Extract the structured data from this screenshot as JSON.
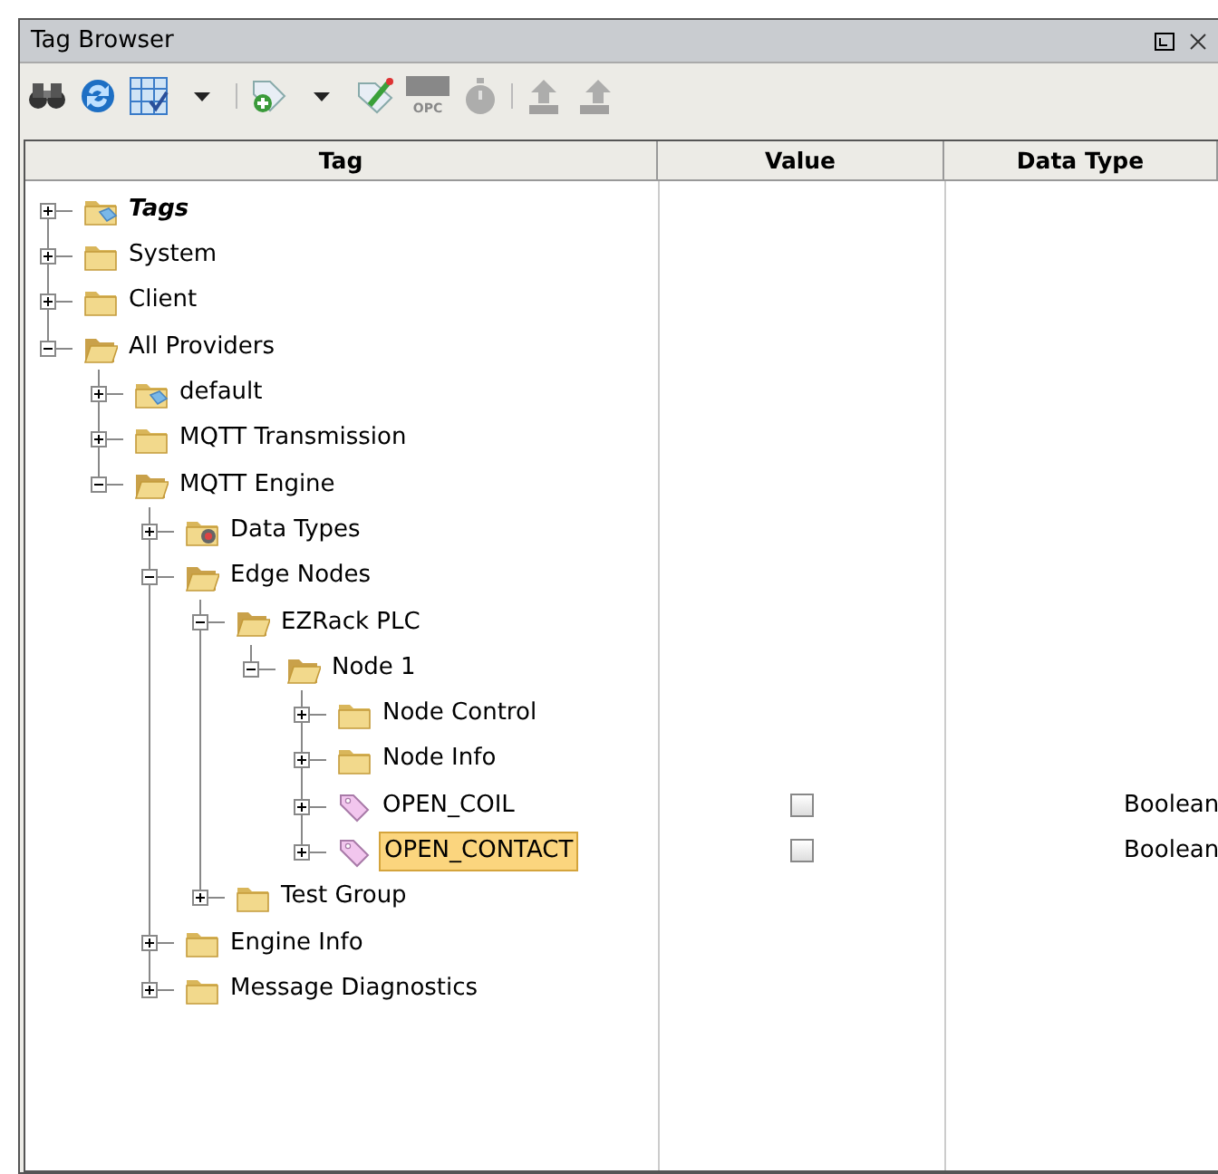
{
  "window": {
    "title": "Tag Browser"
  },
  "toolbar": [
    {
      "kind": "binoculars",
      "disabled": false
    },
    {
      "kind": "refresh",
      "disabled": false
    },
    {
      "kind": "grid",
      "disabled": false
    },
    {
      "kind": "caret",
      "disabled": false
    },
    {
      "kind": "separator"
    },
    {
      "kind": "tag-add",
      "disabled": false
    },
    {
      "kind": "caret",
      "disabled": false
    },
    {
      "kind": "tag-edit",
      "disabled": false
    },
    {
      "kind": "opc",
      "label": "OPC",
      "disabled": true
    },
    {
      "kind": "timer",
      "disabled": true
    },
    {
      "kind": "separator"
    },
    {
      "kind": "export",
      "disabled": true
    },
    {
      "kind": "import",
      "disabled": true
    }
  ],
  "columns": [
    "Tag",
    "Value",
    "Data Type"
  ],
  "tree": [
    {
      "label": "Tags",
      "kind": "root",
      "expanded": false,
      "selected": false
    },
    {
      "label": "System",
      "kind": "folder",
      "expanded": false,
      "selected": false
    },
    {
      "label": "Client",
      "kind": "folder",
      "expanded": false,
      "selected": false
    },
    {
      "label": "All Providers",
      "kind": "folder",
      "expanded": true,
      "selected": false,
      "children": [
        {
          "label": "default",
          "kind": "provider",
          "expanded": false,
          "selected": false
        },
        {
          "label": "MQTT Transmission",
          "kind": "folder",
          "expanded": false,
          "selected": false
        },
        {
          "label": "MQTT Engine",
          "kind": "folder",
          "expanded": true,
          "selected": false,
          "children": [
            {
              "label": "Data Types",
              "kind": "datatypes",
              "expanded": false,
              "selected": false
            },
            {
              "label": "Edge Nodes",
              "kind": "folder",
              "expanded": true,
              "selected": false,
              "children": [
                {
                  "label": "EZRack PLC",
                  "kind": "folder",
                  "expanded": true,
                  "selected": false,
                  "children": [
                    {
                      "label": "Node 1",
                      "kind": "folder",
                      "expanded": true,
                      "selected": false,
                      "children": [
                        {
                          "label": "Node Control",
                          "kind": "folder",
                          "expanded": false,
                          "selected": false
                        },
                        {
                          "label": "Node Info",
                          "kind": "folder",
                          "expanded": false,
                          "selected": false
                        },
                        {
                          "label": "OPEN_COIL",
                          "kind": "tag",
                          "expanded": false,
                          "selected": false,
                          "value": {
                            "checked": false
                          },
                          "data_type": "Boolean"
                        },
                        {
                          "label": "OPEN_CONTACT",
                          "kind": "tag",
                          "expanded": false,
                          "selected": true,
                          "value": {
                            "checked": false
                          },
                          "data_type": "Boolean"
                        }
                      ]
                    }
                  ]
                },
                {
                  "label": "Test Group",
                  "kind": "folder",
                  "expanded": false,
                  "selected": false
                }
              ]
            },
            {
              "label": "Engine Info",
              "kind": "folder",
              "expanded": false,
              "selected": false
            },
            {
              "label": "Message Diagnostics",
              "kind": "folder",
              "expanded": false,
              "selected": false
            }
          ]
        }
      ]
    }
  ]
}
